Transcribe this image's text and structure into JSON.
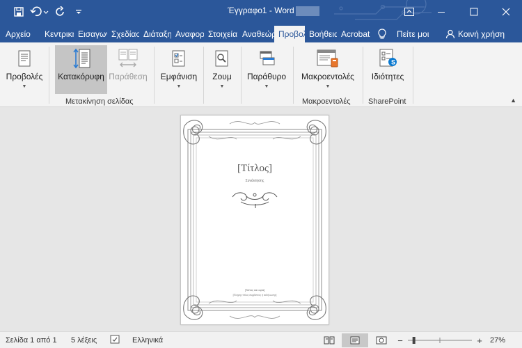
{
  "window": {
    "title": "Έγγραφο1  -  Word"
  },
  "tabs": [
    {
      "label": "Αρχείο"
    },
    {
      "label": "Κεντρική"
    },
    {
      "label": "Εισαγωγή"
    },
    {
      "label": "Σχεδίαση"
    },
    {
      "label": "Διάταξη"
    },
    {
      "label": "Αναφορές"
    },
    {
      "label": "Στοιχεία"
    },
    {
      "label": "Αναθεώρηση"
    },
    {
      "label": "Προβολή"
    },
    {
      "label": "Βοήθεια"
    },
    {
      "label": "Acrobat"
    }
  ],
  "tab_right": {
    "tell_me": "Πείτε μοι",
    "share": "Κοινή χρήση"
  },
  "ribbon": {
    "buttons": [
      {
        "label": "Προβολές"
      },
      {
        "label": "Κατακόρυφη"
      },
      {
        "label": "Παράθεση"
      },
      {
        "label": "Εμφάνιση"
      },
      {
        "label": "Ζουμ"
      },
      {
        "label": "Παράθυρο"
      },
      {
        "label": "Μακροεντολές"
      },
      {
        "label": "Ιδιότητες"
      }
    ],
    "groups": [
      {
        "label": "Μετακίνηση σελίδας"
      },
      {
        "label": "Μακροεντολές"
      },
      {
        "label": "SharePoint"
      }
    ]
  },
  "document": {
    "title": "[Τίτλος]",
    "subtitle": "Συνάντησης",
    "footer_line1": "[Τόπος και ώρα]",
    "footer_line2": "[Πλήρης τίτλος συμβάντος ή εκδήλωσης]"
  },
  "status": {
    "page": "Σελίδα 1 από 1",
    "words": "5 λέξεις",
    "language": "Ελληνικά",
    "zoom": "27%",
    "zoom_level": 0.27
  },
  "colors": {
    "word_blue": "#2b579a",
    "ribbon_bg": "#f3f3f3",
    "selected_button": "#c5c5c5"
  }
}
